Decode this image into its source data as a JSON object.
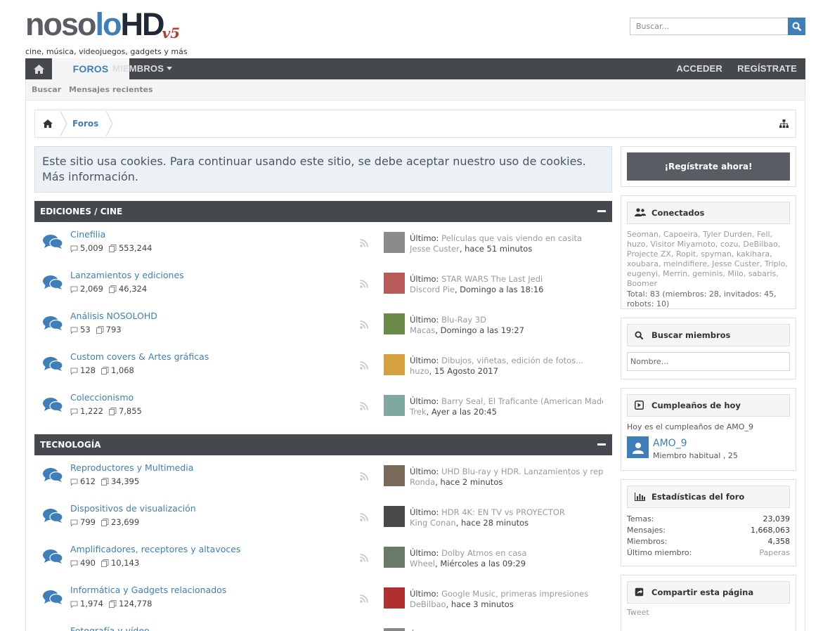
{
  "header": {
    "logo": {
      "part1": "noso",
      "part2": "lo",
      "part3": "HD",
      "version": "v5"
    },
    "tagline": "cine, música, videojuegos, gadgets y más",
    "search_placeholder": "Buscar..."
  },
  "nav": {
    "foros": "FOROS",
    "miembros": "MIEMBROS",
    "acceder": "ACCEDER",
    "registrate": "REGÍSTRATE"
  },
  "subnav": {
    "buscar": "Buscar",
    "recientes": "Mensajes recientes"
  },
  "breadcrumb": {
    "foros": "Foros"
  },
  "cookie_notice": "Este sitio usa cookies. Para continuar usando este sitio, se debe aceptar nuestro uso de cookies. Más información.",
  "categories": [
    {
      "title": "EDICIONES / CINE",
      "forums": [
        {
          "name": "Cinefilia",
          "threads": "5,009",
          "messages": "553,244",
          "last_prefix": "Último:",
          "last_title": "Películas que vais viendo en casita",
          "last_user": "Jesse Custer",
          "last_time": "hace 51 minutos"
        },
        {
          "name": "Lanzamientos y ediciones",
          "threads": "2,069",
          "messages": "46,324",
          "last_prefix": "Último:",
          "last_title": "STAR WARS The Last Jedi",
          "last_user": "Discord Pie",
          "last_time": "Domingo a las 18:16"
        },
        {
          "name": "Análisis NOSOLOHD",
          "threads": "53",
          "messages": "793",
          "last_prefix": "Último:",
          "last_title": "Blu-Ray 3D",
          "last_user": "Macas",
          "last_time": "Domingo a las 19:27"
        },
        {
          "name": "Custom covers & Artes gráficas",
          "threads": "128",
          "messages": "1,068",
          "last_prefix": "Último:",
          "last_title": "Dibujos, viñetas, edición de fotos...",
          "last_user": "huzo",
          "last_time": "15 Agosto 2017"
        },
        {
          "name": "Coleccionismo",
          "threads": "1,222",
          "messages": "7,855",
          "last_prefix": "Último:",
          "last_title": "Barry Seal, El Traficante (American Made)",
          "last_user": "Trek",
          "last_time": "Ayer a las 20:45"
        }
      ]
    },
    {
      "title": "TECNOLOGÍA",
      "forums": [
        {
          "name": "Reproductores y Multimedia",
          "threads": "612",
          "messages": "34,395",
          "last_prefix": "Último:",
          "last_title": "UHD Blu-ray y HDR. Lanzamientos y reproductores",
          "last_user": "Ronda",
          "last_time": "hace 2 minutos"
        },
        {
          "name": "Dispositivos de visualización",
          "threads": "799",
          "messages": "23,699",
          "last_prefix": "Último:",
          "last_title": "HDR 4K: EN TV vs PROYECTOR",
          "last_user": "King Conan",
          "last_time": "hace 28 minutos"
        },
        {
          "name": "Amplificadores, receptores y altavoces",
          "threads": "490",
          "messages": "10,143",
          "last_prefix": "Último:",
          "last_title": "Dolby Atmos en casa",
          "last_user": "Wheel",
          "last_time": "Miércoles a las 09:29"
        },
        {
          "name": "Informática y Gadgets relacionados",
          "threads": "1,974",
          "messages": "124,778",
          "last_prefix": "Último:",
          "last_title": "Google Music, primeras impresiones",
          "last_user": "DeBilbao",
          "last_time": "hace 3 minutos"
        },
        {
          "name": "Fotografía y vídeo",
          "threads": "",
          "messages": "",
          "last_prefix": "Último:",
          "last_title": "",
          "last_user": "",
          "last_time": ""
        }
      ]
    }
  ],
  "sidebar": {
    "register_button": "¡Regístrate ahora!",
    "online": {
      "title": "Conectados",
      "users": "Seoman, Capoeira, Tyler Durden, Fell, huzo, Visitor Miyamoto, cozu, DeBilbao, Projecte ZX, Ropit, spyman, kakihara, xoubara, meindifiere, Jesse Custer, Triplo, eugenyi, Merrin, geminis, Milo, sabaris, Boomer",
      "total": "Total: 83 (miembros: 28, invitados: 45, robots: 10)"
    },
    "member_search": {
      "title": "Buscar miembros",
      "placeholder": "Nombre..."
    },
    "birthdays": {
      "title": "Cumpleaños de hoy",
      "text": "Hoy es el cumpleaños de AMO_9",
      "name": "AMO_9",
      "role": "Miembro habitual , 25"
    },
    "stats": {
      "title": "Estadísticas del foro",
      "rows": [
        {
          "label": "Temas:",
          "value": "23,039"
        },
        {
          "label": "Mensajes:",
          "value": "1,668,063"
        },
        {
          "label": "Miembros:",
          "value": "4,358"
        },
        {
          "label": "Último miembro:",
          "value": "Paperas"
        }
      ]
    },
    "share": {
      "title": "Compartir esta página",
      "tweet": "Tweet"
    }
  },
  "colors": {
    "accent": "#3e7fb9",
    "nav": "#45494e",
    "muted": "#9a9a9a"
  },
  "icons": [
    "home-icon",
    "search-icon",
    "sitemap-icon",
    "chat-bubbles-icon",
    "rss-icon",
    "users-icon",
    "play-icon",
    "chart-icon",
    "share-icon",
    "user-icon"
  ]
}
